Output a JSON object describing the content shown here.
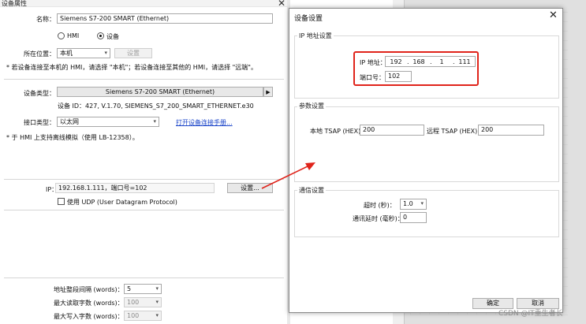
{
  "left": {
    "title": "设备属性",
    "name_label": "名称：",
    "name_value": "Siemens S7-200 SMART (Ethernet)",
    "radio_hmi": "HMI",
    "radio_device": "设备",
    "location_label": "所在位置：",
    "location_value": "本机",
    "settings_btn_disabled": "设置",
    "location_note": "* 若设备连接至本机的 HMI，请选择 \"本机\"；若设备连接至其他的 HMI，请选择 \"远端\"。",
    "device_type_label": "设备类型：",
    "device_type_value": "Siemens S7-200 SMART (Ethernet)",
    "device_info": "设备 ID：427, V.1.70, SIEMENS_S7_200_SMART_ETHERNET.e30",
    "interface_label": "接口类型：",
    "interface_value": "以太网",
    "manual_link": "打开设备连接手册...",
    "sim_note": "* 于 HMI 上支持离线模拟（使用 LB-12358）。",
    "ip_label": "IP：",
    "ip_value": "192.168.1.111，端口号=102",
    "ip_settings_btn": "设置...",
    "udp_label": "使用 UDP (User Datagram Protocol)",
    "addr_gap_label": "地址整段间隔 (words)：",
    "addr_gap_value": "5",
    "max_read_label": "最大读取字数 (words)：",
    "max_read_value": "100",
    "max_write_label": "最大写入字数 (words)：",
    "max_write_value": "100"
  },
  "dialog": {
    "title": "设备设置",
    "ip_group": "IP 地址设置",
    "ip_label": "IP 地址：",
    "ip": [
      "192",
      "168",
      "1",
      "111"
    ],
    "port_label": "端口号：",
    "port_value": "102",
    "param_group": "参数设置",
    "local_tsap_label": "本地 TSAP (HEX)：",
    "local_tsap_value": "200",
    "remote_tsap_label": "远程 TSAP (HEX)：",
    "remote_tsap_value": "200",
    "comm_group": "通信设置",
    "timeout_label": "超时 (秒)：",
    "timeout_value": "1.0",
    "comm_delay_label": "通讯延时 (毫秒)：",
    "comm_delay_value": "0",
    "ok": "确定",
    "cancel": "取消"
  },
  "watermark": "CSDN @IT重生者长",
  "colors": {
    "highlight": "#e0241b",
    "link": "#1a44c9"
  }
}
